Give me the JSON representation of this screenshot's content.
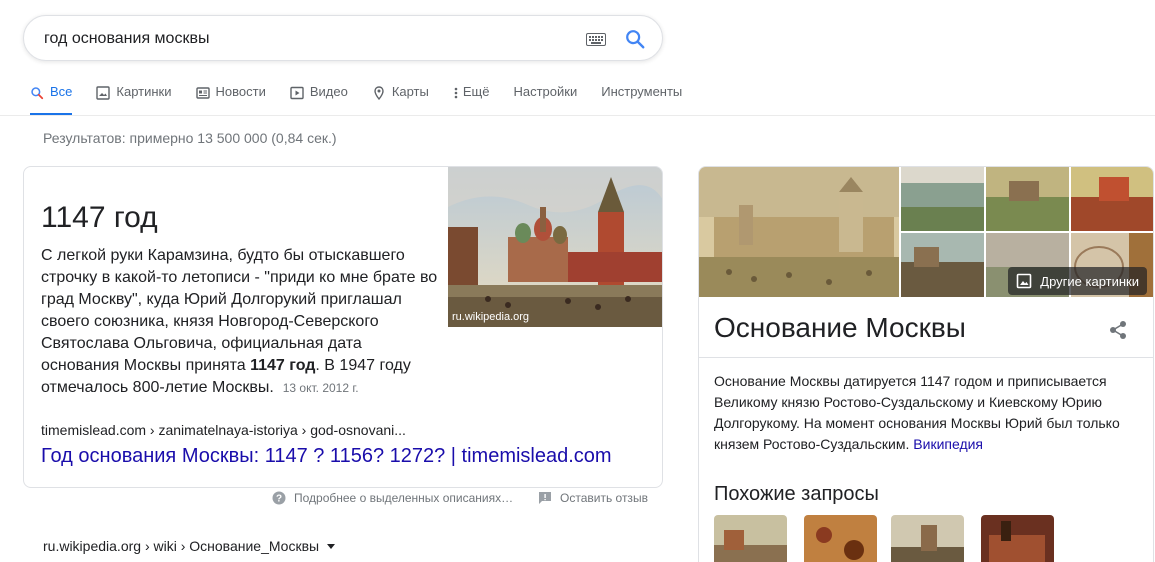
{
  "search": {
    "query": "год основания москвы"
  },
  "tabs": [
    {
      "label": "Все",
      "icon": "search-icon",
      "active": true
    },
    {
      "label": "Картинки",
      "icon": "image-icon"
    },
    {
      "label": "Новости",
      "icon": "news-icon"
    },
    {
      "label": "Видео",
      "icon": "video-icon"
    },
    {
      "label": "Карты",
      "icon": "map-pin-icon"
    },
    {
      "label": "Ещё",
      "icon": "more-vert-icon"
    },
    {
      "label": "Настройки"
    },
    {
      "label": "Инструменты"
    }
  ],
  "results_stats": "Результатов: примерно 13 500 000 (0,84 сек.)",
  "snippet": {
    "answer": "1147 год",
    "text_before": "С легкой руки Карамзина, будто бы отыскавшего строчку в какой-то летописи - \"приди ко мне брате во град Москву\", куда Юрий Долгорукий приглашал своего союзника, князя Новгород-Северского Святослава Ольговича, официальная дата основания Москвы принята ",
    "text_bold": "1147 год",
    "text_after": ". В 1947 году отмечалось 800-летие Москвы.",
    "date": "13 окт. 2012 г.",
    "image_caption": "ru.wikipedia.org",
    "cite": "timemislead.com › zanimatelnaya-istoriya › god-osnovani...",
    "link_title": "Год основания Москвы: 1147 ? 1156? 1272? | timemislead.com"
  },
  "below_snippet": {
    "about": "Подробнее о выделенных описаниях…",
    "feedback": "Оставить отзыв"
  },
  "next_result": {
    "cite": "ru.wikipedia.org › wiki › Основание_Москвы"
  },
  "knowledge_panel": {
    "more_images": "Другие картинки",
    "title": "Основание Москвы",
    "description": "Основание Москвы датируется 1147 годом и приписывается Великому князю Ростово-Суздальскому и Киевскому Юрию Долгорукому. На момент основания Москвы Юрий был только князем Ростово-Суздальским.",
    "source_link": "Википедия",
    "related_title": "Похожие запросы"
  },
  "colors": {
    "accent": "#1a73e8",
    "link": "#1a0dab",
    "muted": "#70757a"
  }
}
